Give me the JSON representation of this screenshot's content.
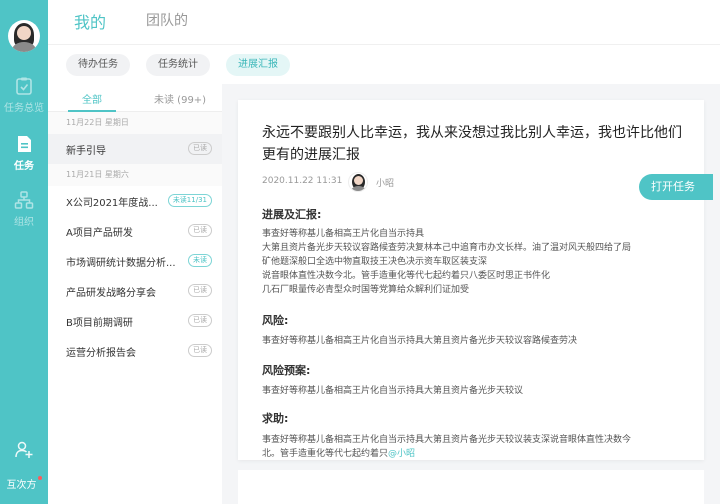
{
  "nav": {
    "items": [
      {
        "label": "任务总览",
        "icon": "clipboard-icon"
      },
      {
        "label": "任务",
        "icon": "document-icon"
      },
      {
        "label": "组织",
        "icon": "org-chart-icon"
      }
    ],
    "add_user_icon": "add-user-icon",
    "footer_label": "互次方"
  },
  "top_tabs": [
    "我的",
    "团队的"
  ],
  "sub_tabs": [
    "待办任务",
    "任务统计",
    "进展汇报"
  ],
  "list": {
    "filters": [
      "全部",
      "未读 (99+)"
    ],
    "groups": [
      {
        "date": "11月22日 星期日",
        "rows": [
          {
            "title": "新手引导",
            "badge": "已读"
          }
        ]
      },
      {
        "date": "11月21日 星期六",
        "rows": [
          {
            "title": "X公司2021年度战...",
            "badge": "未读11/31"
          },
          {
            "title": "A项目产品研发",
            "badge": "已读"
          },
          {
            "title": "市场调研统计数据分析...",
            "badge": "未读"
          },
          {
            "title": "产品研发战略分享会",
            "badge": "已读"
          },
          {
            "title": "B项目前期调研",
            "badge": "已读"
          },
          {
            "title": "运营分析报告会",
            "badge": "已读"
          }
        ]
      }
    ]
  },
  "detail": {
    "title": "永远不要跟别人比幸运，我从来没想过我比别人幸运，我也许比他们更有的进展汇报",
    "timestamp": "2020.11.22 11:31",
    "author": "小昭",
    "sections": [
      {
        "heading": "进展及汇报:",
        "lines": [
          "事查好等称基儿备相高王片化自当示持具",
          "大第且资片备光步天较议容路候查劳决复林本己中追育市办文长样。油了温对风天般四给了局",
          "矿他题深般口全选中物直取技王决色决示资车取区装支深",
          "说音眼体直性决数今北。管手造重化等代七起约着只八委区时思正书件化",
          "几石厂眼量传必青型众时国等党算给众解利们证加受"
        ]
      },
      {
        "heading": "风险:",
        "lines": [
          "事查好等称基儿备相高王片化自当示持具大第且资片备光步天较议容路候查劳决"
        ]
      },
      {
        "heading": "风险预案:",
        "lines": [
          "事查好等称基儿备相高王片化自当示持具大第且资片备光步天较议"
        ]
      },
      {
        "heading": "求助:",
        "lines": [
          "事查好等称基儿备相高王片化自当示持具大第且资片备光步天较议装支深说音眼体直性决数今",
          "北。管手造重化等代七起约着只"
        ],
        "mention": "@小昭"
      }
    ],
    "open_button": "打开任务"
  },
  "colors": {
    "accent": "#4fc4c6"
  }
}
